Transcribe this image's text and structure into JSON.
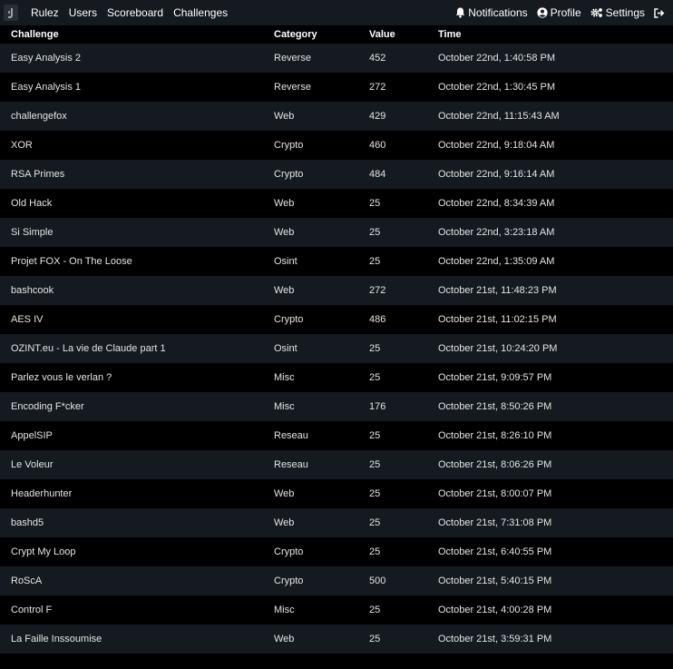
{
  "nav": {
    "left": [
      {
        "label": "Rulez",
        "name": "nav-rulez"
      },
      {
        "label": "Users",
        "name": "nav-users"
      },
      {
        "label": "Scoreboard",
        "name": "nav-scoreboard"
      },
      {
        "label": "Challenges",
        "name": "nav-challenges"
      }
    ],
    "right": {
      "notifications": "Notifications",
      "profile": "Profile",
      "settings": "Settings"
    }
  },
  "table": {
    "headers": [
      "Challenge",
      "Category",
      "Value",
      "Time"
    ],
    "rows": [
      [
        "Easy Analysis 2",
        "Reverse",
        "452",
        "October 22nd, 1:40:58 PM"
      ],
      [
        "Easy Analysis 1",
        "Reverse",
        "272",
        "October 22nd, 1:30:45 PM"
      ],
      [
        "challengefox",
        "Web",
        "429",
        "October 22nd, 11:15:43 AM"
      ],
      [
        "XOR",
        "Crypto",
        "460",
        "October 22nd, 9:18:04 AM"
      ],
      [
        "RSA Primes",
        "Crypto",
        "484",
        "October 22nd, 9:16:14 AM"
      ],
      [
        "Old Hack",
        "Web",
        "25",
        "October 22nd, 8:34:39 AM"
      ],
      [
        "Si Simple",
        "Web",
        "25",
        "October 22nd, 3:23:18 AM"
      ],
      [
        "Projet FOX - On The Loose",
        "Osint",
        "25",
        "October 22nd, 1:35:09 AM"
      ],
      [
        "bashcook",
        "Web",
        "272",
        "October 21st, 11:48:23 PM"
      ],
      [
        "AES IV",
        "Crypto",
        "486",
        "October 21st, 11:02:15 PM"
      ],
      [
        "OZINT.eu - La vie de Claude part 1",
        "Osint",
        "25",
        "October 21st, 10:24:20 PM"
      ],
      [
        "Parlez vous le verlan ?",
        "Misc",
        "25",
        "October 21st, 9:09:57 PM"
      ],
      [
        "Encoding F*cker",
        "Misc",
        "176",
        "October 21st, 8:50:26 PM"
      ],
      [
        "AppelSIP",
        "Reseau",
        "25",
        "October 21st, 8:26:10 PM"
      ],
      [
        "Le Voleur",
        "Reseau",
        "25",
        "October 21st, 8:06:26 PM"
      ],
      [
        "Headerhunter",
        "Web",
        "25",
        "October 21st, 8:00:07 PM"
      ],
      [
        "bashd5",
        "Web",
        "25",
        "October 21st, 7:31:08 PM"
      ],
      [
        "Crypt My Loop",
        "Crypto",
        "25",
        "October 21st, 6:40:55 PM"
      ],
      [
        "RoScA",
        "Crypto",
        "500",
        "October 21st, 5:40:15 PM"
      ],
      [
        "Control F",
        "Misc",
        "25",
        "October 21st, 4:00:28 PM"
      ],
      [
        "La Faille Inssoumise",
        "Web",
        "25",
        "October 21st, 3:59:31 PM"
      ]
    ]
  }
}
